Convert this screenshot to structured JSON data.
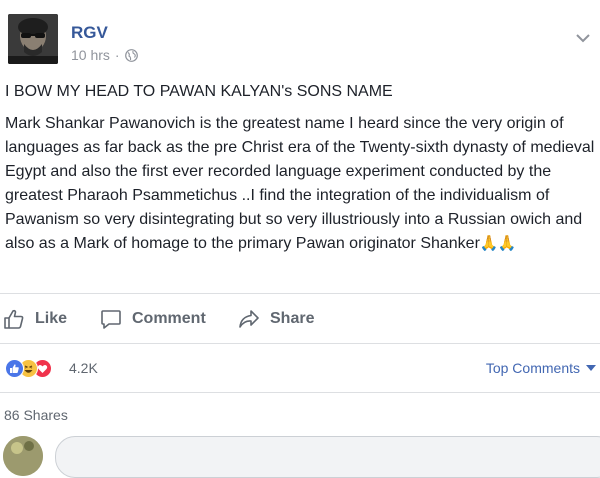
{
  "post": {
    "author": "RGV",
    "time": "10 hrs",
    "dot": "·",
    "title": "I BOW MY HEAD TO PAWAN KALYAN's SONS NAME",
    "text": "Mark Shankar Pawanovich is the greatest name I heard since the very origin of languages as far back as the pre Christ era of the Twenty-sixth dynasty of medieval Egypt and also the first ever recorded language experiment conducted by the greatest Pharaoh Psammetichus ..I find the integration of the individualism of Pawanism so very disintegrating but so very illustriously into a Russian owich and also as a Mark of homage to the primary Pawan originator Shanker",
    "emoji": "🙏🙏"
  },
  "actions": {
    "like": "Like",
    "comment": "Comment",
    "share": "Share"
  },
  "reactions": {
    "count": "4.2K",
    "icons": [
      "like-reaction-icon",
      "haha-reaction-icon",
      "love-reaction-icon"
    ],
    "top_comments": "Top Comments"
  },
  "shares": {
    "label": "86 Shares"
  },
  "colors": {
    "link_blue": "#365899",
    "accent_blue": "#4267b2",
    "muted": "#90949c",
    "action_gray": "#606770",
    "divider": "#dddfe2"
  }
}
